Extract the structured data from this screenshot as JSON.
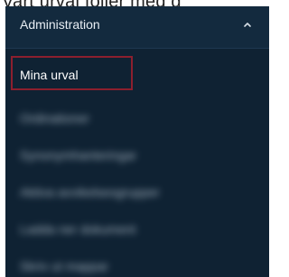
{
  "header_text": "Vart urval följer med g",
  "sidebar": {
    "section_title": "Administration",
    "chevron_icon": "chevron-up-icon",
    "items": [
      {
        "label": "Mina urval",
        "blurred": false
      },
      {
        "label": "Ordinationer",
        "blurred": true
      },
      {
        "label": "Synonymhanteringar",
        "blurred": true
      },
      {
        "label": "Aktiva avvikelsesgrupper",
        "blurred": true
      },
      {
        "label": "Ladda ner dokument",
        "blurred": true
      },
      {
        "label": "Skriv ut mappar",
        "blurred": true
      }
    ]
  },
  "colors": {
    "panel_bg": "#0f2233",
    "header_bg": "#132a3e",
    "highlight_border": "#8c1f2e",
    "text": "#ffffff"
  }
}
